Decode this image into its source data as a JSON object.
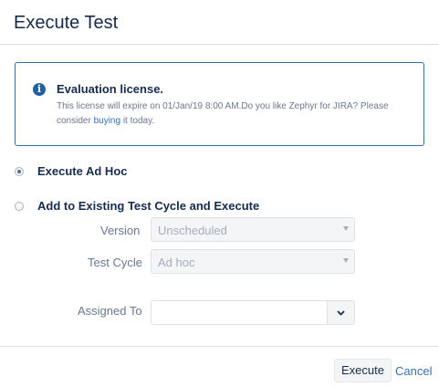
{
  "dialog": {
    "title": "Execute Test"
  },
  "info": {
    "icon": "info-icon",
    "title": "Evaluation license.",
    "text_before_link": "This license will expire on 01/Jan/19 8:00 AM.Do you like Zephyr for JIRA? Please consider ",
    "link_text": "buying",
    "text_after_link": " it today."
  },
  "options": {
    "adhoc": {
      "label": "Execute Ad Hoc",
      "selected": true
    },
    "existing": {
      "label": "Add to Existing Test Cycle and Execute",
      "selected": false
    }
  },
  "fields": {
    "version": {
      "label": "Version",
      "value": "Unscheduled"
    },
    "test_cycle": {
      "label": "Test Cycle",
      "value": "Ad hoc"
    },
    "assigned_to": {
      "label": "Assigned To",
      "value": ""
    }
  },
  "footer": {
    "execute_label": "Execute",
    "cancel_label": "Cancel"
  },
  "colors": {
    "accent": "#3572b0",
    "info_border": "#2f6fa8",
    "title": "#172b4d"
  }
}
